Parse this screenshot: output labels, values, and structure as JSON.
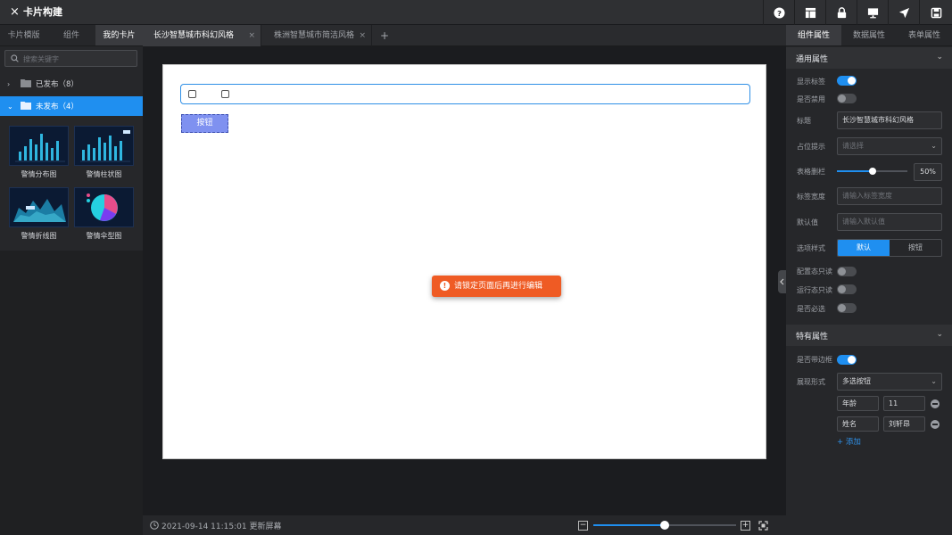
{
  "app": {
    "title": "卡片构建",
    "close_icon": "×"
  },
  "toolbar": {
    "icons": [
      "help-icon",
      "layout-icon",
      "lock-icon",
      "monitor-icon",
      "send-icon",
      "save-icon"
    ]
  },
  "left_panel": {
    "tabs": [
      "卡片模版",
      "组件",
      "我的卡片"
    ],
    "active_tab": 2,
    "search_placeholder": "搜索关键字",
    "tree": [
      {
        "label": "已发布（8）",
        "arrow": "›",
        "selected": false
      },
      {
        "label": "未发布（4）",
        "arrow": "⌄",
        "selected": true
      }
    ],
    "cards": [
      {
        "caption": "警情分布图"
      },
      {
        "caption": "警情柱状图"
      },
      {
        "caption": "警情折线图"
      },
      {
        "caption": "警情伞型图"
      }
    ]
  },
  "editor_tabs": {
    "items": [
      {
        "label": "长沙智慧城市科幻风格",
        "close": "×",
        "active": true
      },
      {
        "label": "株洲智慧城市简洁风格",
        "close": "×",
        "active": false
      }
    ],
    "add_label": "+"
  },
  "canvas": {
    "button_label": "按钮",
    "toast": {
      "icon": "!",
      "message": "请锁定页面后再进行编辑"
    }
  },
  "status_bar": {
    "text": "2021-09-14 11:15:01 更新屏幕",
    "zoom_minus": "−",
    "zoom_plus": "+",
    "zoom_fraction": 0.5
  },
  "right_panel": {
    "tabs": [
      "组件属性",
      "数据属性",
      "表单属性"
    ],
    "active_tab": 0,
    "general": {
      "title": "通用属性",
      "chevron": "⌄",
      "show_label": {
        "label": "显示标签",
        "on": true
      },
      "disabled": {
        "label": "是否禁用",
        "on": false
      },
      "title_field": {
        "label": "标题",
        "value": "长沙智慧城市科幻风格"
      },
      "placeholder_field": {
        "label": "占位提示",
        "value": "请选择",
        "dd": "⌄"
      },
      "grid": {
        "label": "表格删栏",
        "value": "50%",
        "fraction": 0.5
      },
      "label_width": {
        "label": "标签宽度",
        "placeholder": "请输入标签宽度"
      },
      "default_value": {
        "label": "默认值",
        "placeholder": "请输入默认值"
      },
      "option_style": {
        "label": "选项样式",
        "options": [
          "默认",
          "按钮"
        ],
        "selected": 0
      },
      "config_readonly": {
        "label": "配置态只读",
        "on": false
      },
      "runtime_readonly": {
        "label": "运行态只读",
        "on": false
      },
      "required": {
        "label": "是否必选",
        "on": false
      }
    },
    "special": {
      "title": "特有属性",
      "chevron": "⌄",
      "bordered": {
        "label": "是否带边框",
        "on": true
      },
      "display_mode": {
        "label": "展现形式",
        "value": "多选按钮",
        "dd": "⌄"
      },
      "options": [
        {
          "name": "年龄",
          "value": "11"
        },
        {
          "name": "姓名",
          "value": "刘轩昂"
        }
      ],
      "add_label": "+ 添加"
    }
  },
  "colors": {
    "accent": "#1f8ff0",
    "toast": "#ef5b24",
    "canvas_button": "#7f91f0"
  }
}
